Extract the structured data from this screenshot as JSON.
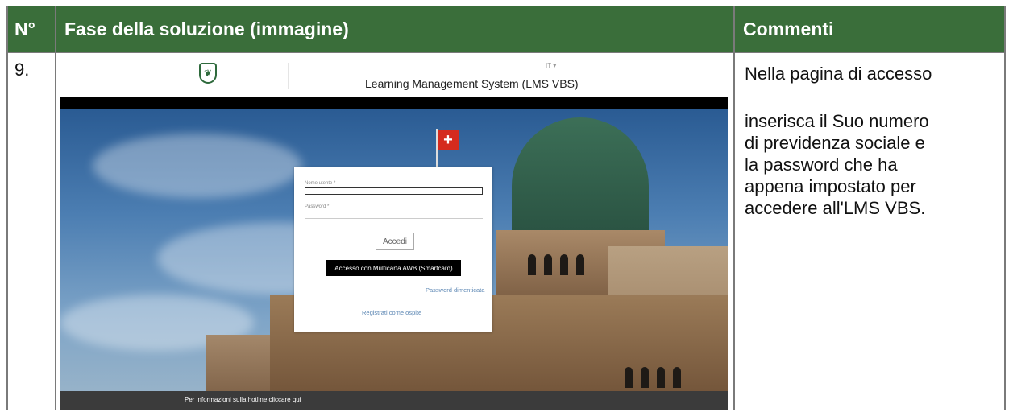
{
  "table": {
    "headers": {
      "num": "N°",
      "phase": "Fase della soluzione (immagine)",
      "comments": "Commenti"
    },
    "row": {
      "num": "9.",
      "comment_lines": [
        "Nella pagina di accesso",
        "",
        "inserisca il Suo numero",
        "di previdenza sociale e",
        "la password che ha",
        "appena impostato per",
        "accedere all'LMS VBS."
      ]
    }
  },
  "screenshot": {
    "language": "IT ▾",
    "title": "Learning Management System (LMS VBS)",
    "help_icon": "?",
    "flag_cross": "+",
    "login": {
      "username_label": "Nome utente *",
      "password_label": "Password *",
      "login_button": "Accedi",
      "smartcard_button": "Accesso con Multicarta AWB (Smartcard)",
      "forgot_password": "Password dimenticata",
      "guest_register": "Registrati come ospite"
    },
    "footer": "Per informazioni sulla hotline cliccare qui"
  },
  "colors": {
    "header_bg": "#3a6e3a",
    "header_text": "#ffffff",
    "link": "#5b86b3"
  }
}
